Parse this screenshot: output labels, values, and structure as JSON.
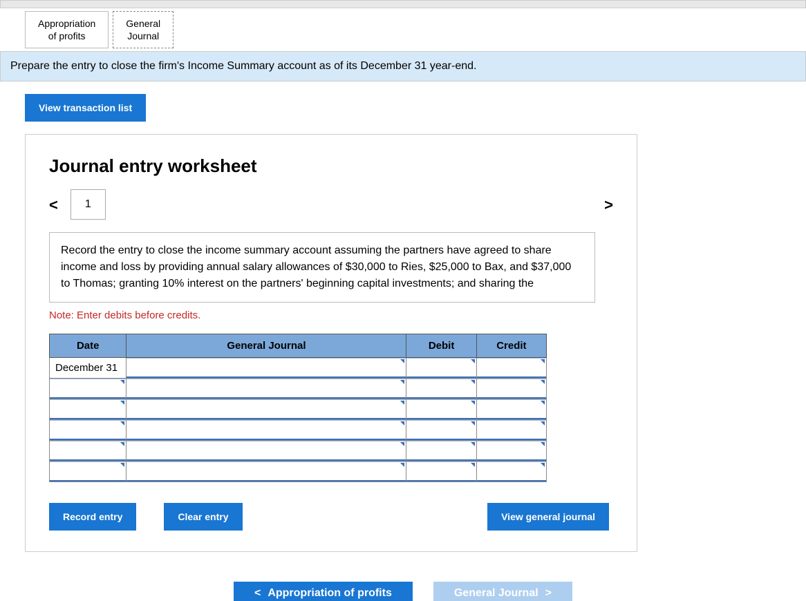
{
  "tabs": {
    "appropriation": "Appropriation\nof profits",
    "general_journal": "General\nJournal"
  },
  "instruction": "Prepare the entry to close the firm's Income Summary account as of its December 31 year-end.",
  "view_transaction_list": "View transaction list",
  "worksheet": {
    "title": "Journal entry worksheet",
    "step": "1",
    "prompt": "Record the entry to close the income summary account assuming the partners have agreed to share income and loss by providing annual salary allowances of $30,000 to Ries, $25,000 to Bax, and $37,000 to Thomas; granting 10% interest on the partners' beginning capital investments; and sharing the",
    "note": "Note: Enter debits before credits.",
    "headers": {
      "date": "Date",
      "gj": "General Journal",
      "debit": "Debit",
      "credit": "Credit"
    },
    "rows": [
      {
        "date": "December 31",
        "gj": "",
        "debit": "",
        "credit": ""
      },
      {
        "date": "",
        "gj": "",
        "debit": "",
        "credit": ""
      },
      {
        "date": "",
        "gj": "",
        "debit": "",
        "credit": ""
      },
      {
        "date": "",
        "gj": "",
        "debit": "",
        "credit": ""
      },
      {
        "date": "",
        "gj": "",
        "debit": "",
        "credit": ""
      },
      {
        "date": "",
        "gj": "",
        "debit": "",
        "credit": ""
      }
    ]
  },
  "buttons": {
    "record": "Record entry",
    "clear": "Clear entry",
    "view_gj": "View general journal"
  },
  "bottom_nav": {
    "prev": "Appropriation of profits",
    "next": "General Journal"
  }
}
